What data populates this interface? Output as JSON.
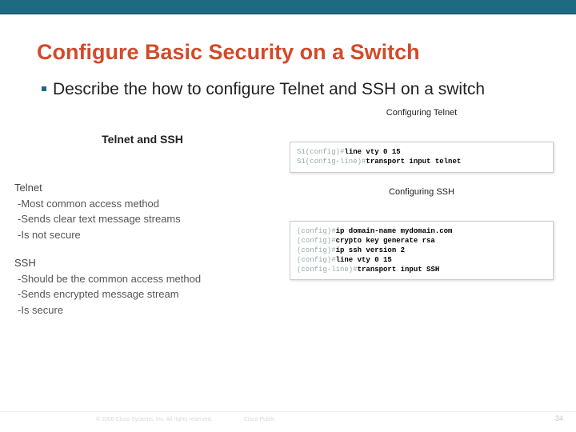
{
  "title": "Configure Basic Security on a Switch",
  "bullet": "Describe the how to configure Telnet and SSH on a switch",
  "left": {
    "heading": "Telnet and SSH",
    "telnet": {
      "name": "Telnet",
      "items": [
        "-Most common access method",
        "-Sends clear text message streams",
        "-Is not secure"
      ]
    },
    "ssh": {
      "name": "SSH",
      "items": [
        "-Should be the common access method",
        "-Sends encrypted message stream",
        "-Is secure"
      ]
    }
  },
  "right": {
    "telnet": {
      "label": "Configuring Telnet",
      "lines": [
        {
          "prompt": "S1(config)#",
          "cmd": "line vty 0 15"
        },
        {
          "prompt": "S1(config-line)#",
          "cmd": "transport input telnet"
        }
      ]
    },
    "ssh": {
      "label": "Configuring SSH",
      "lines": [
        {
          "prompt": "(config)#",
          "cmd": "ip domain-name mydomain.com"
        },
        {
          "prompt": "(config)#",
          "cmd": "crypto key generate rsa"
        },
        {
          "prompt": "(config)#",
          "cmd": "ip ssh version 2"
        },
        {
          "prompt": "(config)#",
          "cmd": "line vty 0 15"
        },
        {
          "prompt": "(config-line)#",
          "cmd": "transport input SSH"
        }
      ]
    }
  },
  "footer": {
    "copyright": "© 2006 Cisco Systems, Inc. All rights reserved.",
    "public": "Cisco Public",
    "page": "34"
  }
}
